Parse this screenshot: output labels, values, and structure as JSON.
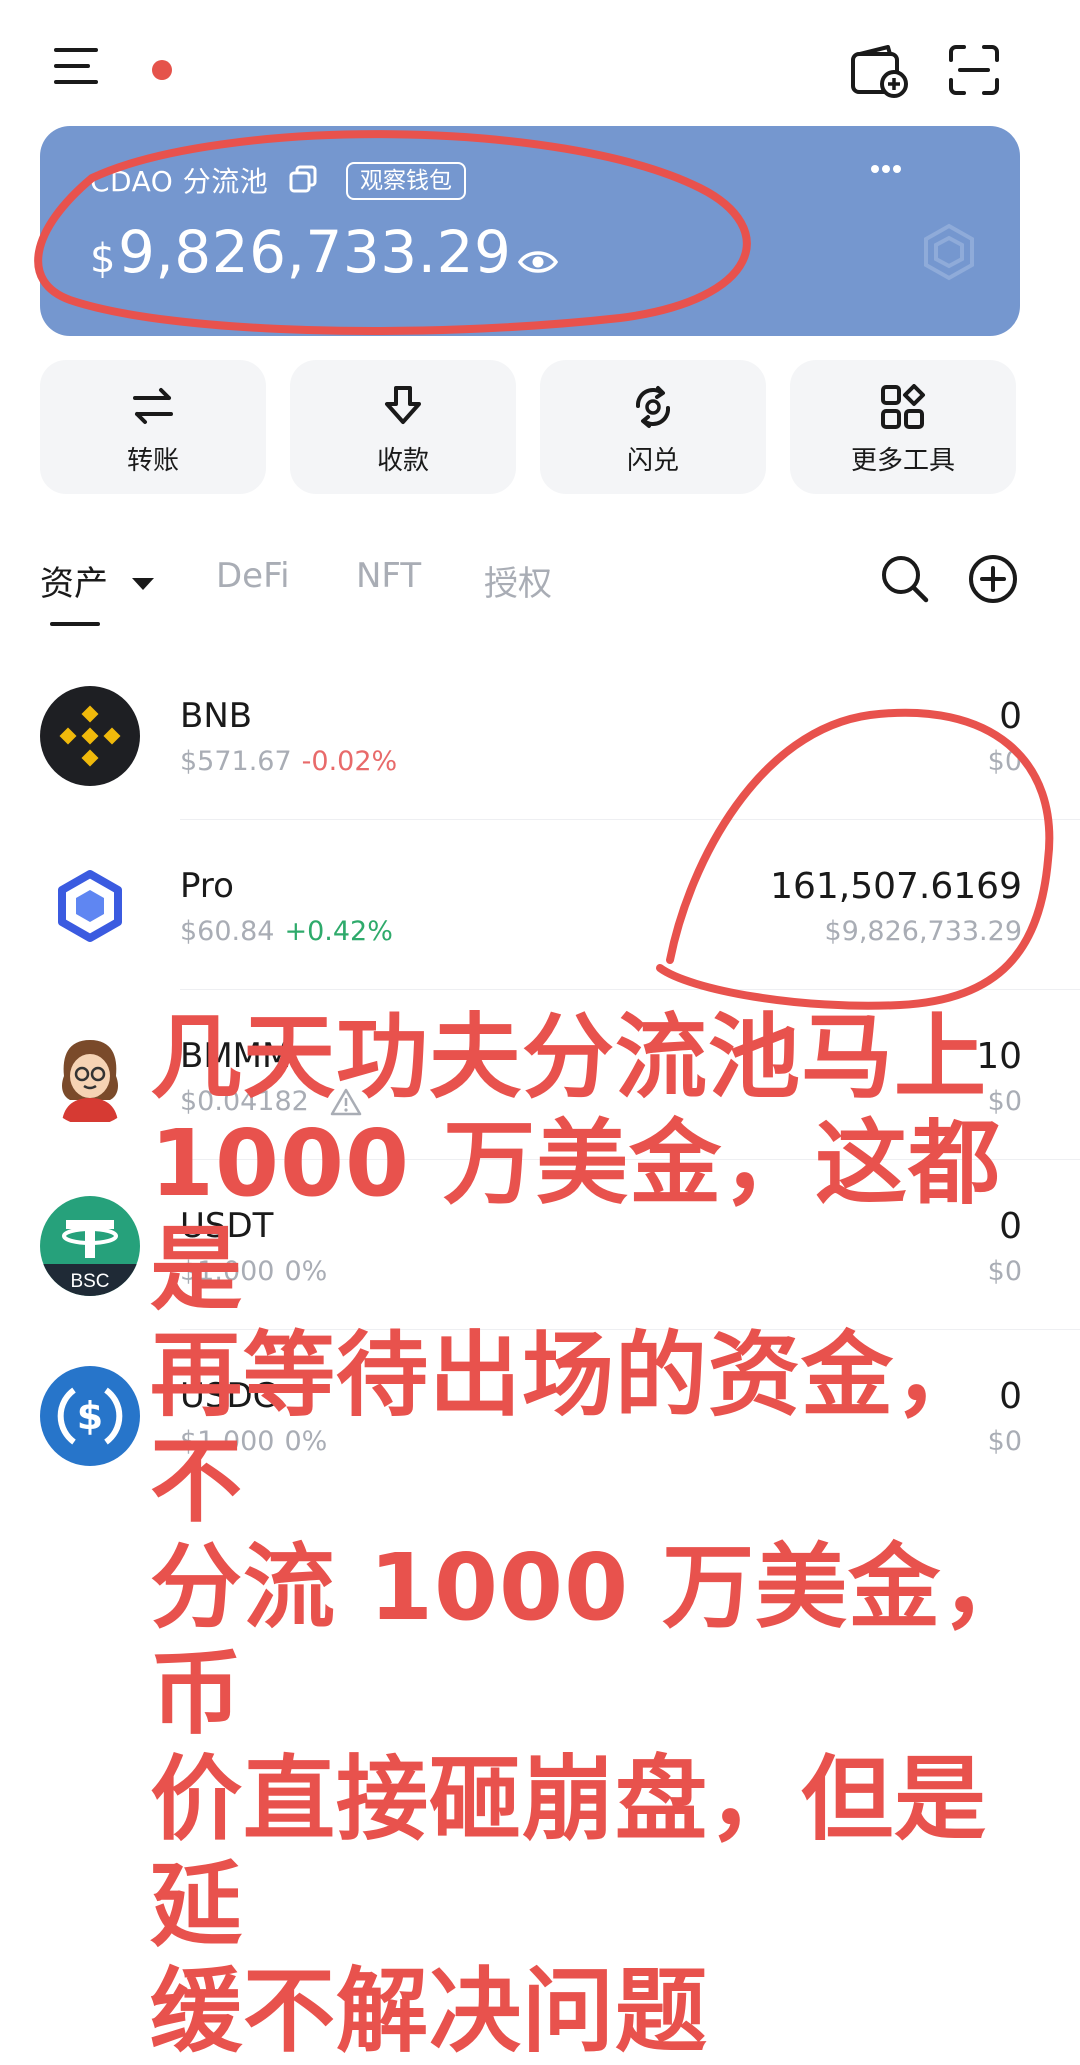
{
  "topbar": {
    "notification_dot_color": "#e5534b",
    "icons": [
      "menu-icon",
      "add-wallet-icon",
      "scan-icon"
    ]
  },
  "wallet_card": {
    "name": "CDAO 分流池",
    "badge": "观察钱包",
    "currency_symbol": "$",
    "balance": "9,826,733.29",
    "background_color": "#7597cf"
  },
  "actions": [
    {
      "label": "转账",
      "icon": "transfer-icon"
    },
    {
      "label": "收款",
      "icon": "receive-icon"
    },
    {
      "label": "闪兑",
      "icon": "swap-icon"
    },
    {
      "label": "更多工具",
      "icon": "more-tools-icon"
    }
  ],
  "tabs": [
    {
      "label": "资产",
      "active": true
    },
    {
      "label": "DeFi",
      "active": false
    },
    {
      "label": "NFT",
      "active": false
    },
    {
      "label": "授权",
      "active": false
    }
  ],
  "assets": [
    {
      "symbol": "BNB",
      "price": "$571.67",
      "change": "-0.02%",
      "amount": "0",
      "value": "$0"
    },
    {
      "symbol": "Pro",
      "price": "$60.84",
      "change": "+0.42%",
      "amount": "161,507.6169",
      "value": "$9,826,733.29"
    },
    {
      "symbol": "BMMM",
      "price": "$0.04182",
      "change": "",
      "amount": "10",
      "value": "$0"
    },
    {
      "symbol": "USDT",
      "price": "$1.000",
      "change": "0%",
      "amount": "0",
      "value": "$0"
    },
    {
      "symbol": "USDC",
      "price": "$1.000",
      "change": "0%",
      "amount": "0",
      "value": "$0"
    }
  ],
  "overlay": {
    "color": "#e8524d",
    "lines": [
      "几天功夫分流池马上",
      "1000 万美金，这都是",
      "再等待出场的资金，不",
      "分流 1000 万美金，币",
      "价直接砸崩盘，但是延",
      "缓不解决问题"
    ]
  }
}
